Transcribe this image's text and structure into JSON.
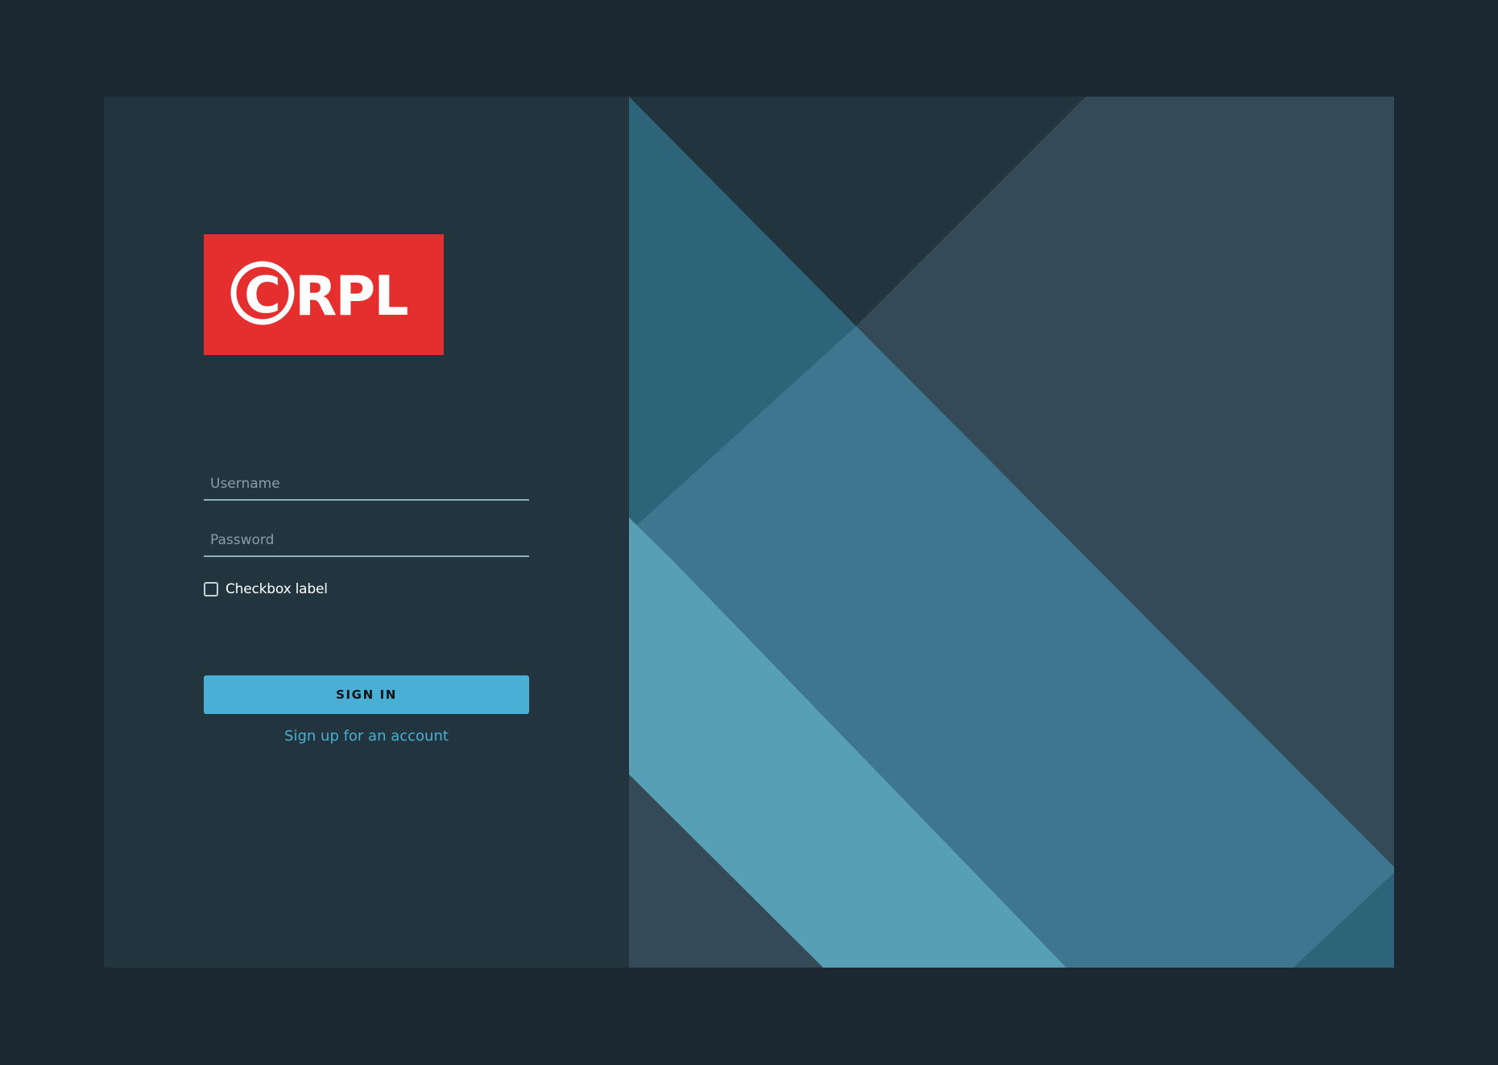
{
  "colors": {
    "page_background": "#1b2832",
    "form_panel_background": "#22343d",
    "accent": "#4aafd5",
    "logo_background": "#e52f2f",
    "logo_foreground": "#ffffff",
    "art_base": "#22343d",
    "art_slate": "#344a57",
    "art_deep_teal": "#2e6479",
    "art_mid_blue": "#3d768e",
    "art_light_blue": "#569fb4"
  },
  "logo": {
    "text": "©RPL",
    "letters": "RPL",
    "symbol": "C"
  },
  "form": {
    "username": {
      "placeholder": "Username",
      "value": ""
    },
    "password": {
      "placeholder": "Password",
      "value": ""
    },
    "remember": {
      "label": "Checkbox label",
      "checked": false
    },
    "submit_label": "SIGN IN",
    "signup_link": "Sign up for an account"
  },
  "background_art": {
    "style": "geometric diagonal bands",
    "icon": "decorative-shapes"
  }
}
